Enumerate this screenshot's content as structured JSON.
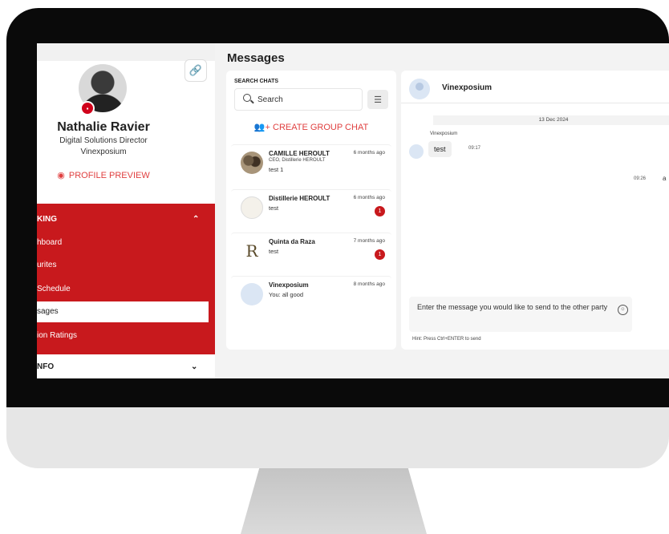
{
  "page_title": "Messages",
  "sidebar": {
    "profile": {
      "name": "Nathalie Ravier",
      "role": "Digital Solutions Director",
      "company": "Vinexposium",
      "preview_label": "PROFILE PREVIEW"
    },
    "section_label": "KING",
    "items": [
      {
        "label": "hboard",
        "active": false
      },
      {
        "label": "urites",
        "active": false
      },
      {
        "label": "Schedule",
        "active": false
      },
      {
        "label": "sages",
        "active": true
      },
      {
        "label": "ion Ratings",
        "active": false
      }
    ],
    "info_label": "NFO"
  },
  "chats": {
    "search_label": "SEARCH CHATS",
    "search_placeholder": "Search",
    "create_group_label": "CREATE GROUP CHAT",
    "items": [
      {
        "name": "CAMILLE HEROULT",
        "subtitle": "CEO, Distillerie HEROULT",
        "last_message": "test 1",
        "time": "6 months ago",
        "unread": ""
      },
      {
        "name": "Distillerie HEROULT",
        "subtitle": "",
        "last_message": "test",
        "time": "6 months ago",
        "unread": "1"
      },
      {
        "name": "Quinta da Raza",
        "subtitle": "",
        "last_message": "test",
        "time": "7 months ago",
        "unread": "1"
      },
      {
        "name": "Vinexposium",
        "subtitle": "",
        "last_message": "You: all good",
        "time": "8 months ago",
        "unread": ""
      }
    ]
  },
  "conversation": {
    "name": "Vinexposium",
    "date": "13 Dec 2024",
    "incoming_sender": "Vinexposium",
    "incoming_text": "test",
    "incoming_time": "09:17",
    "outgoing_time": "09:26",
    "outgoing_text": "a",
    "composer_placeholder": "Enter the message you would like to send to the other party",
    "hint": "Hint: Press Ctrl+ENTER to send"
  },
  "colors": {
    "accent_red": "#c8191d",
    "link_red": "#e04040"
  }
}
